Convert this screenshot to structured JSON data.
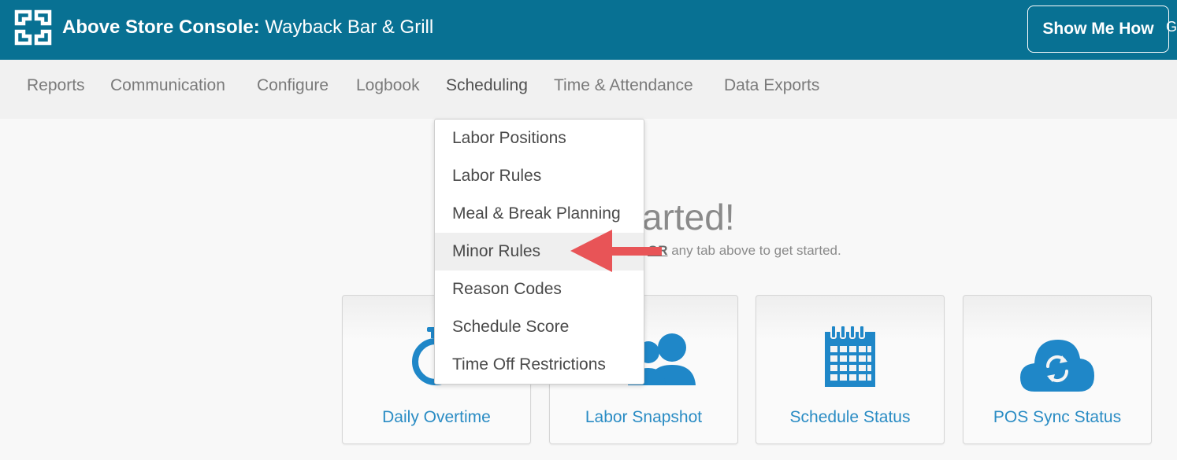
{
  "header": {
    "app_name": "Above Store Console:",
    "store_name": "Wayback Bar & Grill",
    "show_me_how": "Show Me How",
    "cutoff_text": "G"
  },
  "nav": {
    "items": [
      {
        "label": "Reports"
      },
      {
        "label": "Communication"
      },
      {
        "label": "Configure"
      },
      {
        "label": "Logbook"
      },
      {
        "label": "Scheduling",
        "active": true
      },
      {
        "label": "Time & Attendance"
      },
      {
        "label": "Data Exports"
      }
    ]
  },
  "dropdown": {
    "items": [
      {
        "label": "Labor Positions"
      },
      {
        "label": "Labor Rules"
      },
      {
        "label": "Meal & Break Planning"
      },
      {
        "label": "Minor Rules",
        "highlighted": true
      },
      {
        "label": "Reason Codes"
      },
      {
        "label": "Schedule Score"
      },
      {
        "label": "Time Off Restrictions"
      }
    ]
  },
  "main": {
    "welcome_partial": "arted!",
    "sub_or": "OR",
    "sub_rest": " any tab above to get started."
  },
  "cards": [
    {
      "label": "Daily Overtime",
      "icon": "stopwatch-icon"
    },
    {
      "label": "Labor Snapshot",
      "icon": "users-icon"
    },
    {
      "label": "Schedule Status",
      "icon": "calendar-icon"
    },
    {
      "label": "POS Sync Status",
      "icon": "cloud-sync-icon"
    }
  ],
  "colors": {
    "header_bg": "#087193",
    "link_blue": "#2a8cc4",
    "icon_blue": "#1f87c8",
    "arrow_red": "#e85457"
  }
}
